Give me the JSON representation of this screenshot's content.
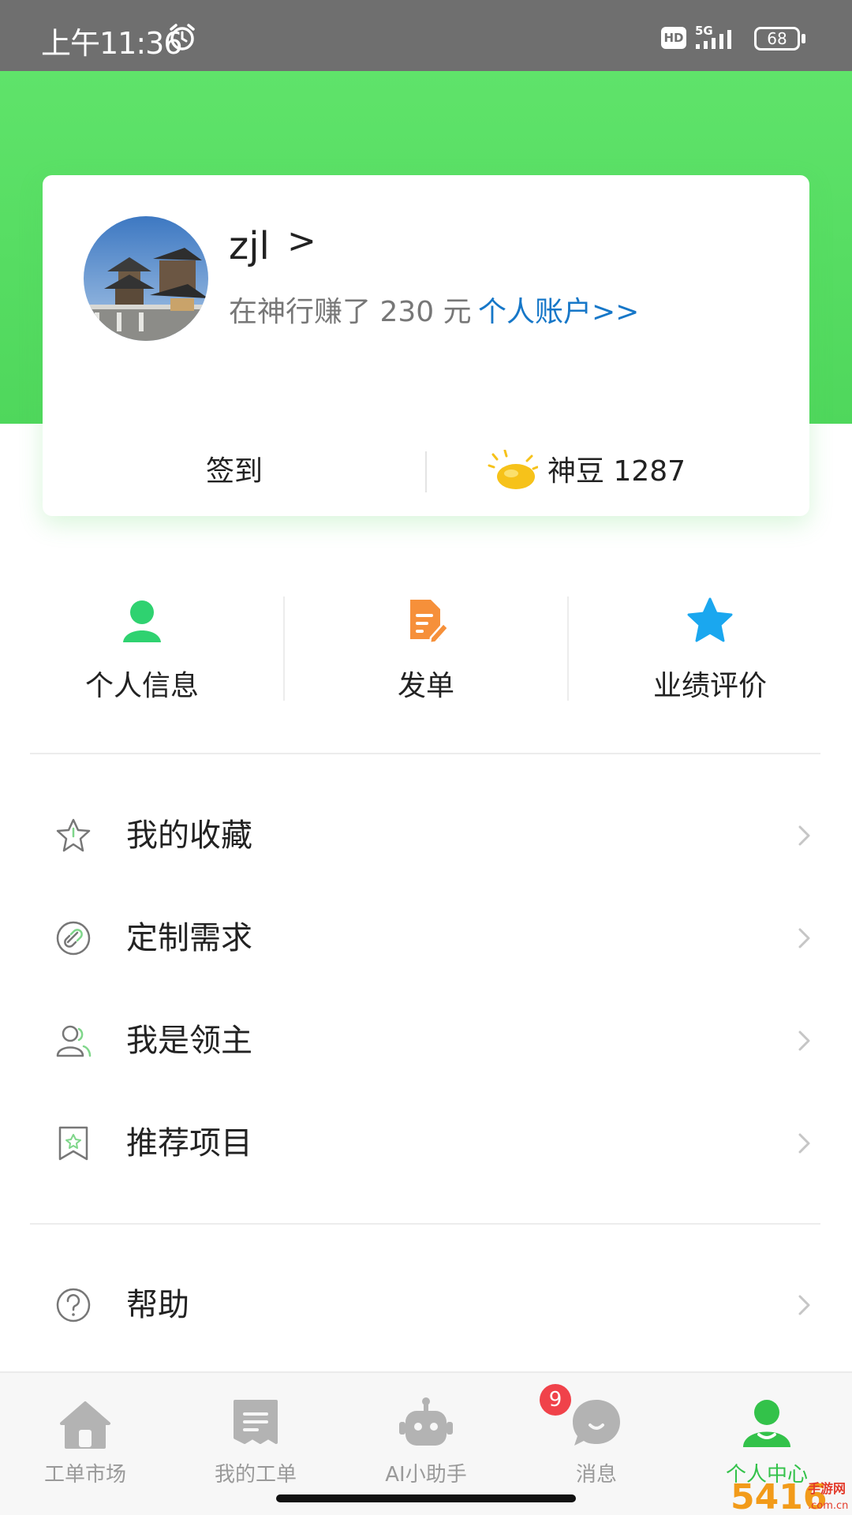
{
  "status_bar": {
    "time": "上午11:36",
    "hd": "HD",
    "network": "5G",
    "battery": "68"
  },
  "profile": {
    "username": "zjl",
    "chevron": ">",
    "earnings_text": "在神行赚了 230 元",
    "account_link": "个人账户>>",
    "sign_in": "签到",
    "beans": "神豆 1287"
  },
  "quick_actions": [
    {
      "label": "个人信息",
      "icon": "person-icon",
      "color": "#2fd270"
    },
    {
      "label": "发单",
      "icon": "edit-document-icon",
      "color": "#f6903a"
    },
    {
      "label": "业绩评价",
      "icon": "star-icon",
      "color": "#1aa7ef"
    }
  ],
  "menu": [
    {
      "label": "我的收藏",
      "icon": "star-outline-icon"
    },
    {
      "label": "定制需求",
      "icon": "link-icon"
    },
    {
      "label": "我是领主",
      "icon": "users-icon"
    },
    {
      "label": "推荐项目",
      "icon": "bookmark-icon"
    },
    {
      "label": "帮助",
      "icon": "help-icon"
    }
  ],
  "tabs": [
    {
      "label": "工单市场",
      "icon": "home-icon",
      "active": false
    },
    {
      "label": "我的工单",
      "icon": "ticket-icon",
      "active": false
    },
    {
      "label": "AI小助手",
      "icon": "robot-icon",
      "active": false
    },
    {
      "label": "消息",
      "icon": "chat-icon",
      "active": false,
      "badge": "9"
    },
    {
      "label": "个人中心",
      "icon": "profile-icon",
      "active": true
    }
  ],
  "colors": {
    "header_green": "#54da60",
    "accent_green": "#33c24a",
    "link_blue": "#1677c8",
    "badge_red": "#f0424a"
  },
  "watermark": "5416手游网 .com.cn"
}
